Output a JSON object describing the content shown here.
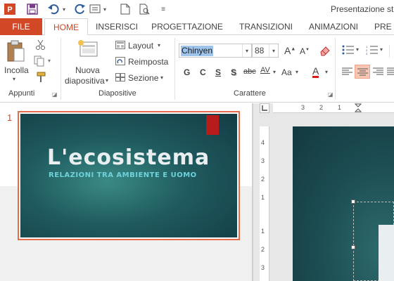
{
  "app": {
    "title": "Presentazione sta"
  },
  "tabs": {
    "file": "FILE",
    "home": "HOME",
    "insert": "INSERISCI",
    "design": "PROGETTAZIONE",
    "transitions": "TRANSIZIONI",
    "animations": "ANIMAZIONI",
    "more": "PRE"
  },
  "ribbon": {
    "clipboard": {
      "paste": "Incolla",
      "label": "Appunti"
    },
    "slides": {
      "new_slide_1": "Nuova",
      "new_slide_2": "diapositiva",
      "layout": "Layout",
      "reset": "Reimposta",
      "section": "Sezione",
      "label": "Diapositive"
    },
    "font": {
      "family": "Chinyen",
      "size": "88",
      "bold": "G",
      "italic": "C",
      "underline": "S",
      "shadow": "S",
      "strike": "abc",
      "spacing": "AV",
      "case": "Aa",
      "color": "A",
      "label": "Carattere"
    }
  },
  "slides": [
    {
      "number": "1",
      "title": "L'ecosistema",
      "subtitle": "RELAZIONI TRA AMBIENTE E UOMO"
    }
  ],
  "ruler": {
    "h_ticks": [
      "3",
      "2",
      "1"
    ],
    "v_ticks": [
      "4",
      "3",
      "2",
      "1",
      "1",
      "2",
      "3"
    ]
  },
  "colors": {
    "accent": "#d24726",
    "slide_dark": "#143c45",
    "slide_mid": "#3a8a85",
    "subtitle": "#6fd2da",
    "red_tab": "#b71c1c"
  }
}
